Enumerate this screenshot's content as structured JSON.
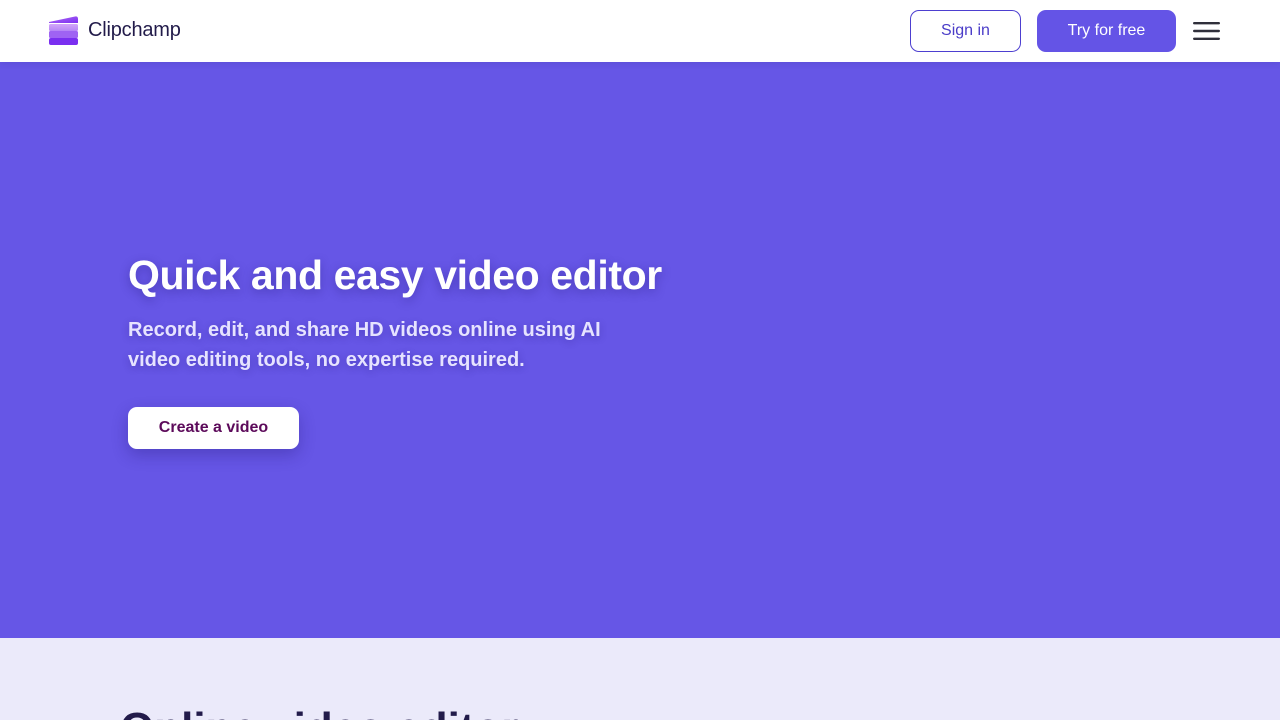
{
  "header": {
    "logo_text": "Clipchamp",
    "sign_in_label": "Sign in",
    "try_free_label": "Try for free"
  },
  "hero": {
    "title": "Quick and easy video editor",
    "subtitle": "Record, edit, and share HD videos online using AI video editing tools, no expertise required.",
    "cta_label": "Create a video"
  },
  "next_section": {
    "title": "Online video editor"
  },
  "icons": {
    "logo": "clipchamp-logo-icon",
    "menu": "hamburger-menu-icon"
  },
  "colors": {
    "brand": "#6454e6",
    "hero_background": "#6656e6",
    "section_background": "#ebeafa",
    "cta_text": "#5c0a5a"
  }
}
